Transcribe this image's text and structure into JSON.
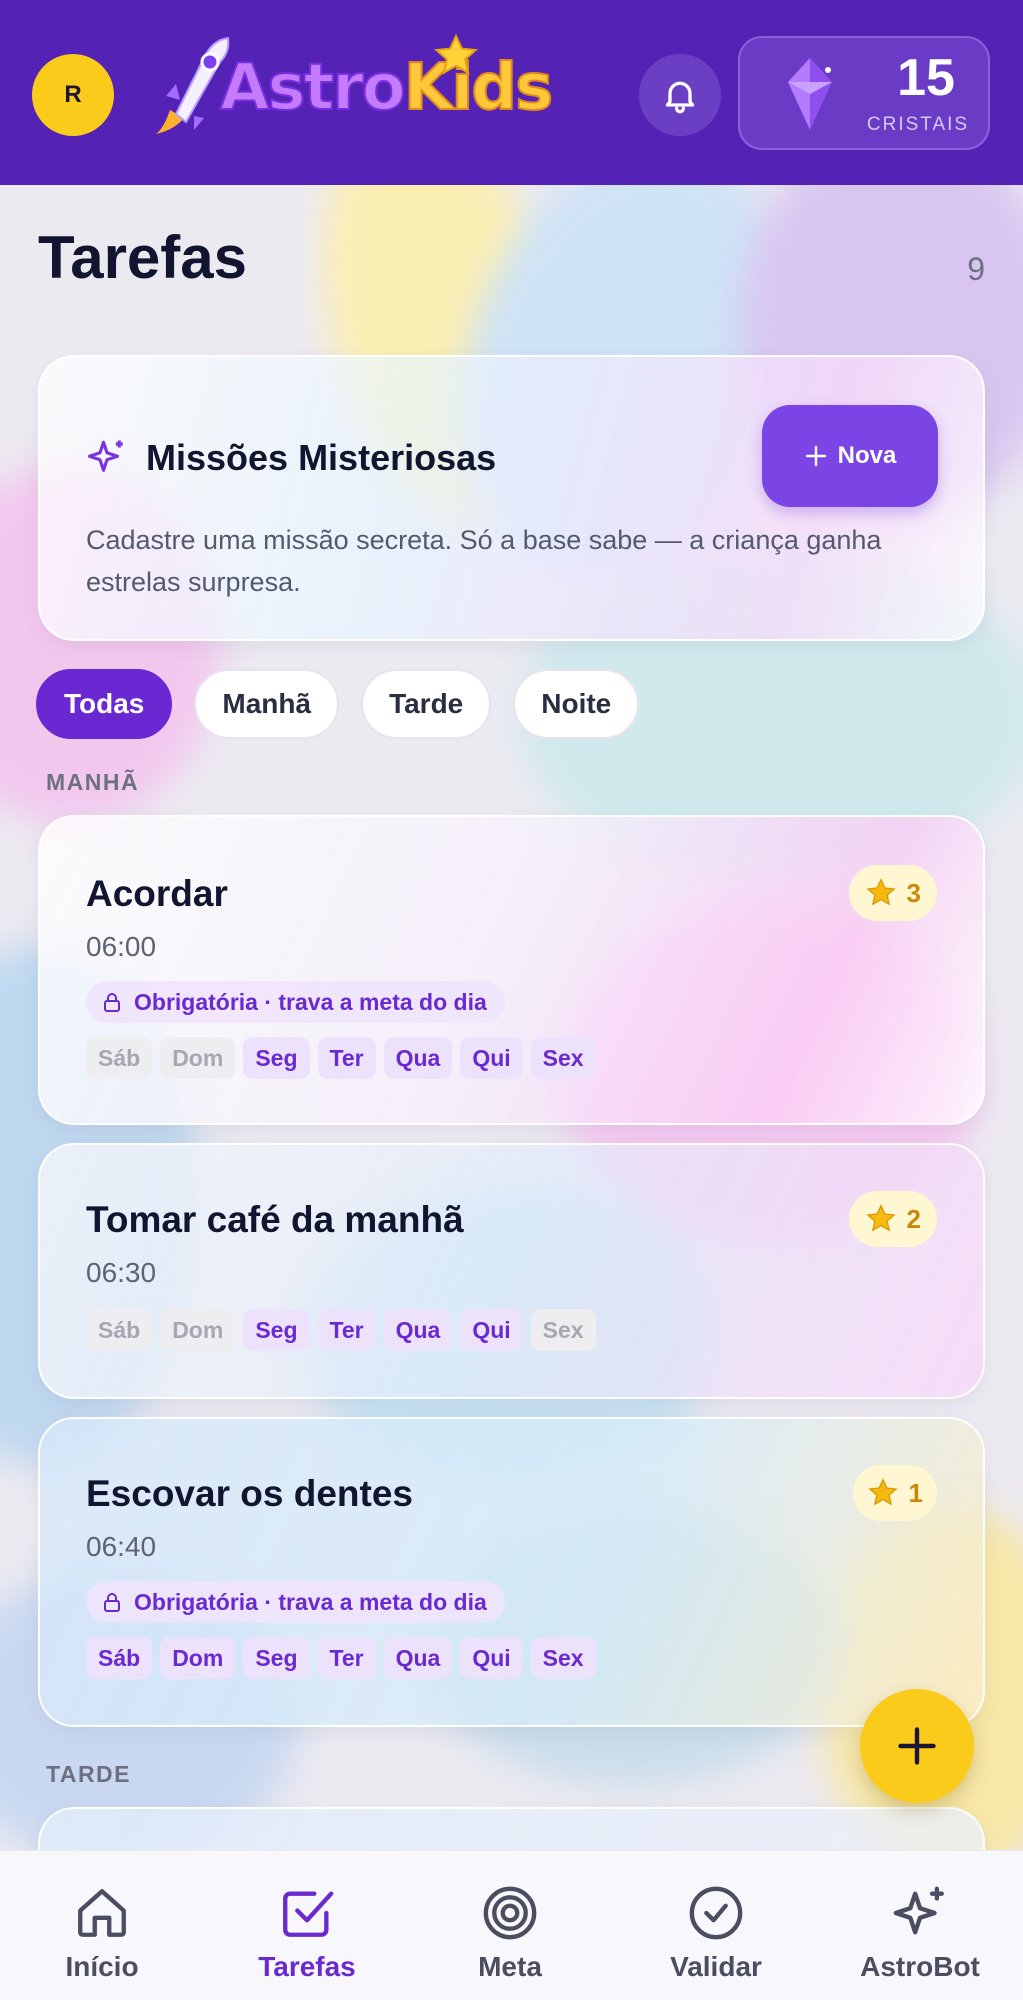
{
  "header": {
    "avatar_initial": "R",
    "logo_part1": "Astro",
    "logo_part2": "Kids",
    "crystals_count": "15",
    "crystals_label": "CRISTAIS"
  },
  "page": {
    "title": "Tarefas",
    "task_count": "9"
  },
  "mystery": {
    "title": "Missões Misteriosas",
    "description": "Cadastre uma missão secreta. Só a base sabe — a criança ganha estrelas surpresa.",
    "new_button": "Nova"
  },
  "filters": [
    "Todas",
    "Manhã",
    "Tarde",
    "Noite"
  ],
  "active_filter": "Todas",
  "sections": {
    "morning": "MANHÃ",
    "afternoon": "TARDE"
  },
  "tasks": [
    {
      "title": "Acordar",
      "time": "06:00",
      "stars": "3",
      "mandatory": "Obrigatória · trava a meta do dia",
      "days": [
        "Sáb",
        "Dom",
        "Seg",
        "Ter",
        "Qua",
        "Qui",
        "Sex"
      ],
      "days_active": [
        false,
        false,
        true,
        true,
        true,
        true,
        true
      ]
    },
    {
      "title": "Tomar café da manhã",
      "time": "06:30",
      "stars": "2",
      "days": [
        "Sáb",
        "Dom",
        "Seg",
        "Ter",
        "Qua",
        "Qui",
        "Sex"
      ],
      "days_active": [
        false,
        false,
        true,
        true,
        true,
        true,
        false
      ]
    },
    {
      "title": "Escovar os dentes",
      "time": "06:40",
      "stars": "1",
      "mandatory": "Obrigatória · trava a meta do dia",
      "days": [
        "Sáb",
        "Dom",
        "Seg",
        "Ter",
        "Qua",
        "Qui",
        "Sex"
      ],
      "days_active": [
        true,
        true,
        true,
        true,
        true,
        true,
        true
      ]
    }
  ],
  "nav": [
    {
      "label": "Início",
      "icon": "home-icon"
    },
    {
      "label": "Tarefas",
      "icon": "checkbox-icon"
    },
    {
      "label": "Meta",
      "icon": "target-icon"
    },
    {
      "label": "Validar",
      "icon": "check-circle-icon"
    },
    {
      "label": "AstroBot",
      "icon": "sparkles-icon"
    }
  ],
  "active_nav": "Tarefas",
  "colors": {
    "header": "#5423b6",
    "accent": "#6b2ad0",
    "button": "#7a45e4",
    "yellow": "#fbcb1b",
    "star": "#f5b910"
  }
}
